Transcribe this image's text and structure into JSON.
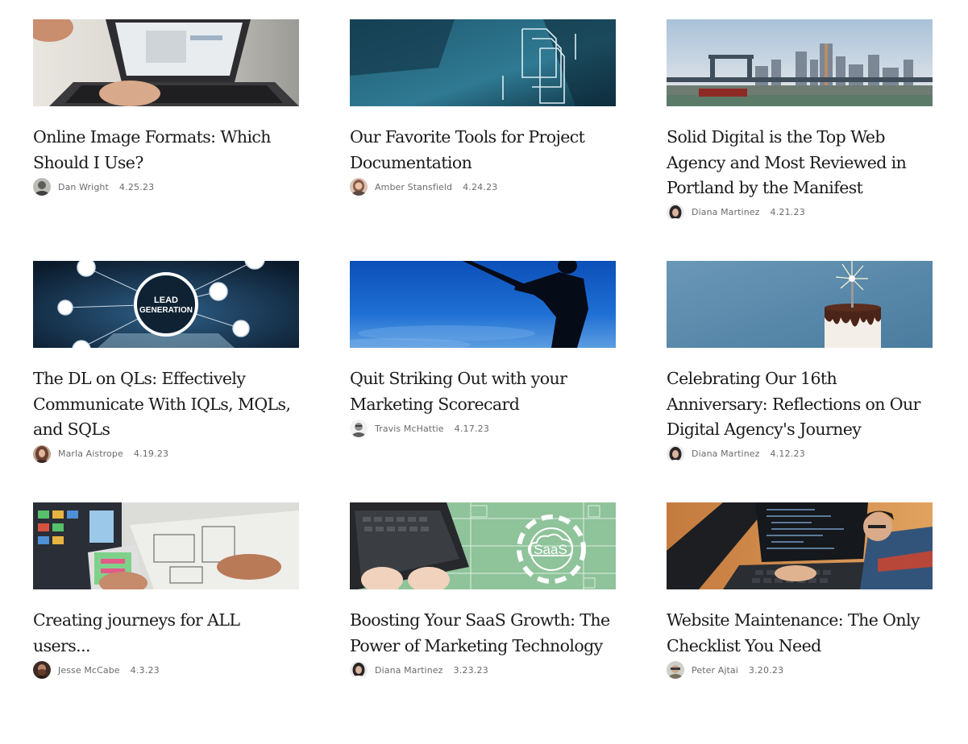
{
  "posts": [
    {
      "title": "Online Image Formats: Which Should I Use?",
      "author": "Dan Wright",
      "date": "4.25.23",
      "image": "laptop-typing-photo",
      "avatar_color": "#5a5f58"
    },
    {
      "title": "Our Favorite Tools for Project Documentation",
      "author": "Amber Stansfield",
      "date": "4.24.23",
      "image": "documents-overlay-photo",
      "avatar_color": "#8a5a45"
    },
    {
      "title": "Solid Digital is the Top Web Agency and Most Reviewed in Portland by the Manifest",
      "author": "Diana Martinez",
      "date": "4.21.23",
      "image": "portland-skyline-photo",
      "avatar_color": "#2a2526"
    },
    {
      "title": "The DL on QLs: Effectively Communicate With IQLs, MQLs, and SQLs",
      "author": "Marla Aistrope",
      "date": "4.19.23",
      "image": "lead-generation-graphic",
      "image_text": "LEAD\nGENERATION",
      "avatar_color": "#6b4030"
    },
    {
      "title": "Quit Striking Out with your Marketing Scorecard",
      "author": "Travis McHattie",
      "date": "4.17.23",
      "image": "baseball-silhouette-photo",
      "avatar_color": "#8e8e8e"
    },
    {
      "title": "Celebrating Our 16th Anniversary: Reflections on Our Digital Agency's Journey",
      "author": "Diana Martinez",
      "date": "4.12.23",
      "image": "birthday-cake-sparkler-photo",
      "avatar_color": "#2a2526"
    },
    {
      "title": "Creating journeys for ALL users...",
      "author": "Jesse McCabe",
      "date": "4.3.23",
      "image": "ux-wireframe-photo",
      "avatar_color": "#6a3b2a"
    },
    {
      "title": "Boosting Your SaaS Growth: The Power of Marketing Technology",
      "author": "Diana Martinez",
      "date": "3.23.23",
      "image": "saas-laptop-graphic",
      "image_text": "SaaS",
      "avatar_color": "#2a2526"
    },
    {
      "title": "Website Maintenance: The Only Checklist You Need",
      "author": "Peter Ajtai",
      "date": "3.20.23",
      "image": "developer-coding-photo",
      "avatar_color": "#7a7060"
    }
  ]
}
